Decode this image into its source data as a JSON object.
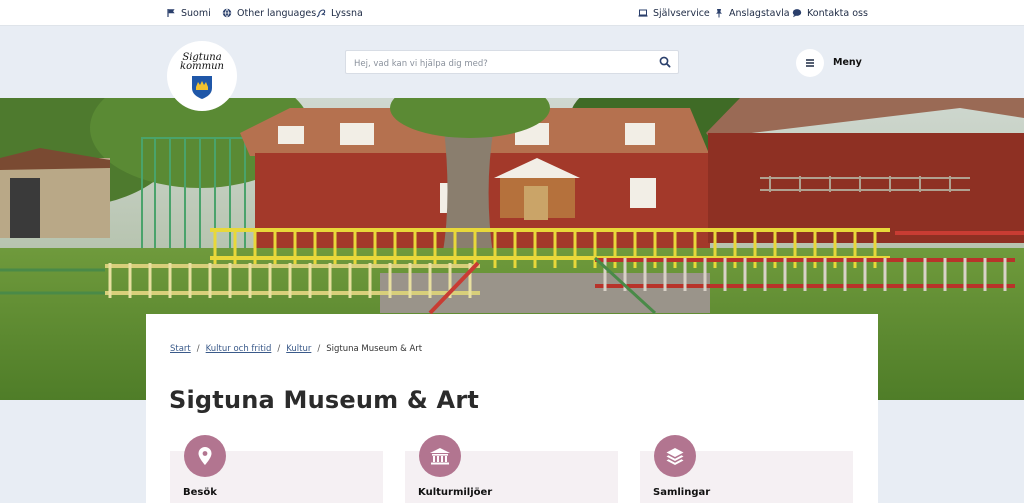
{
  "topbar": {
    "left": [
      {
        "label": "Suomi",
        "icon": "flag-icon"
      },
      {
        "label": "Other languages",
        "icon": "globe-icon"
      },
      {
        "label": "Lyssna",
        "icon": "listen-icon"
      }
    ],
    "right": [
      {
        "label": "Självservice",
        "icon": "laptop-icon"
      },
      {
        "label": "Anslagstavla",
        "icon": "pin-icon"
      },
      {
        "label": "Kontakta oss",
        "icon": "chat-icon"
      }
    ]
  },
  "header": {
    "logo_line1": "Sigtuna",
    "logo_line2": "kommun",
    "search_placeholder": "Hej, vad kan vi hjälpa dig med?",
    "menu_label": "Meny"
  },
  "breadcrumb": {
    "items": [
      "Start",
      "Kultur och fritid",
      "Kultur"
    ],
    "separator": "/",
    "current": "Sigtuna Museum & Art"
  },
  "page": {
    "title": "Sigtuna Museum & Art"
  },
  "tiles": [
    {
      "label": "Besök",
      "icon": "location-pin-icon"
    },
    {
      "label": "Kulturmiljöer",
      "icon": "museum-building-icon"
    },
    {
      "label": "Samlingar",
      "icon": "layers-icon"
    }
  ],
  "colors": {
    "accent": "#b27590",
    "tile_bg": "#f5f0f3",
    "header_bg": "#e8edf4",
    "link": "#3a5a8a",
    "navy": "#1d2a44"
  }
}
